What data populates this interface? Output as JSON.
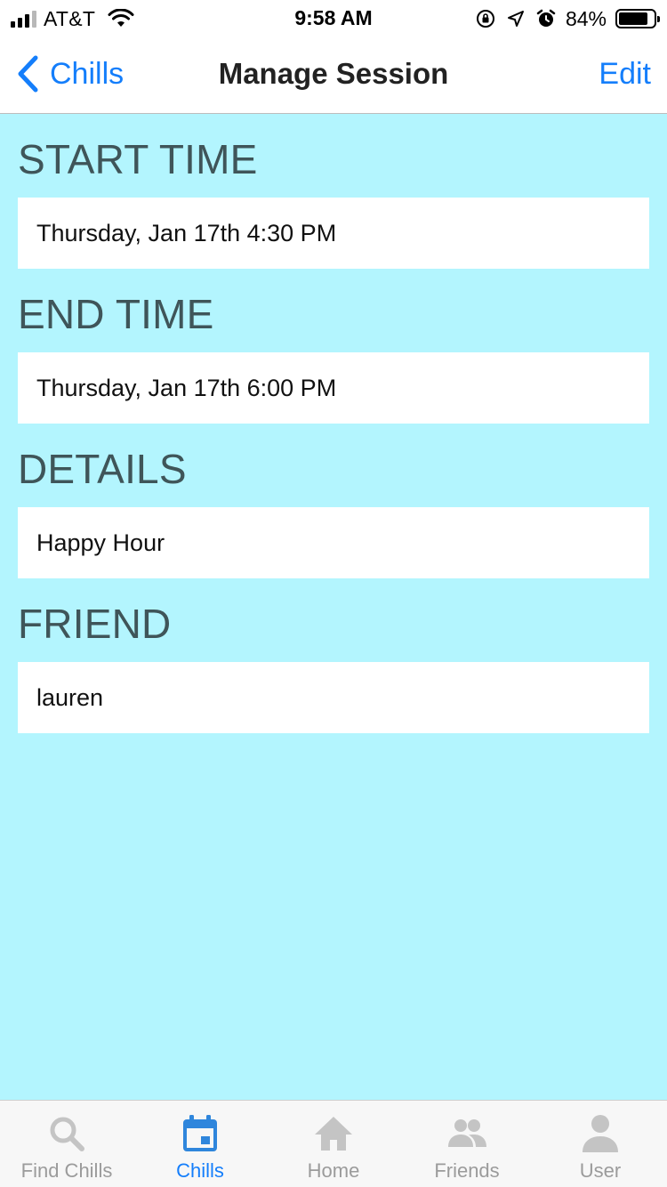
{
  "status_bar": {
    "carrier": "AT&T",
    "time": "9:58 AM",
    "battery_percent": "84%",
    "battery_level": 0.84
  },
  "nav": {
    "back_label": "Chills",
    "title": "Manage Session",
    "edit_label": "Edit"
  },
  "sections": {
    "start": {
      "title": "START TIME",
      "value": "Thursday, Jan 17th 4:30 PM"
    },
    "end": {
      "title": "END TIME",
      "value": "Thursday, Jan 17th 6:00 PM"
    },
    "details": {
      "title": "DETAILS",
      "value": "Happy Hour"
    },
    "friend": {
      "title": "FRIEND",
      "value": "lauren"
    }
  },
  "tabs": [
    {
      "label": "Find Chills",
      "icon": "search-icon",
      "active": false
    },
    {
      "label": "Chills",
      "icon": "calendar-icon",
      "active": true
    },
    {
      "label": "Home",
      "icon": "home-icon",
      "active": false
    },
    {
      "label": "Friends",
      "icon": "friends-icon",
      "active": false
    },
    {
      "label": "User",
      "icon": "user-icon",
      "active": false
    }
  ],
  "colors": {
    "accent": "#147efb",
    "background": "#b3f5fe",
    "section_title": "#3f5559",
    "tab_inactive": "#9b9b9b"
  }
}
